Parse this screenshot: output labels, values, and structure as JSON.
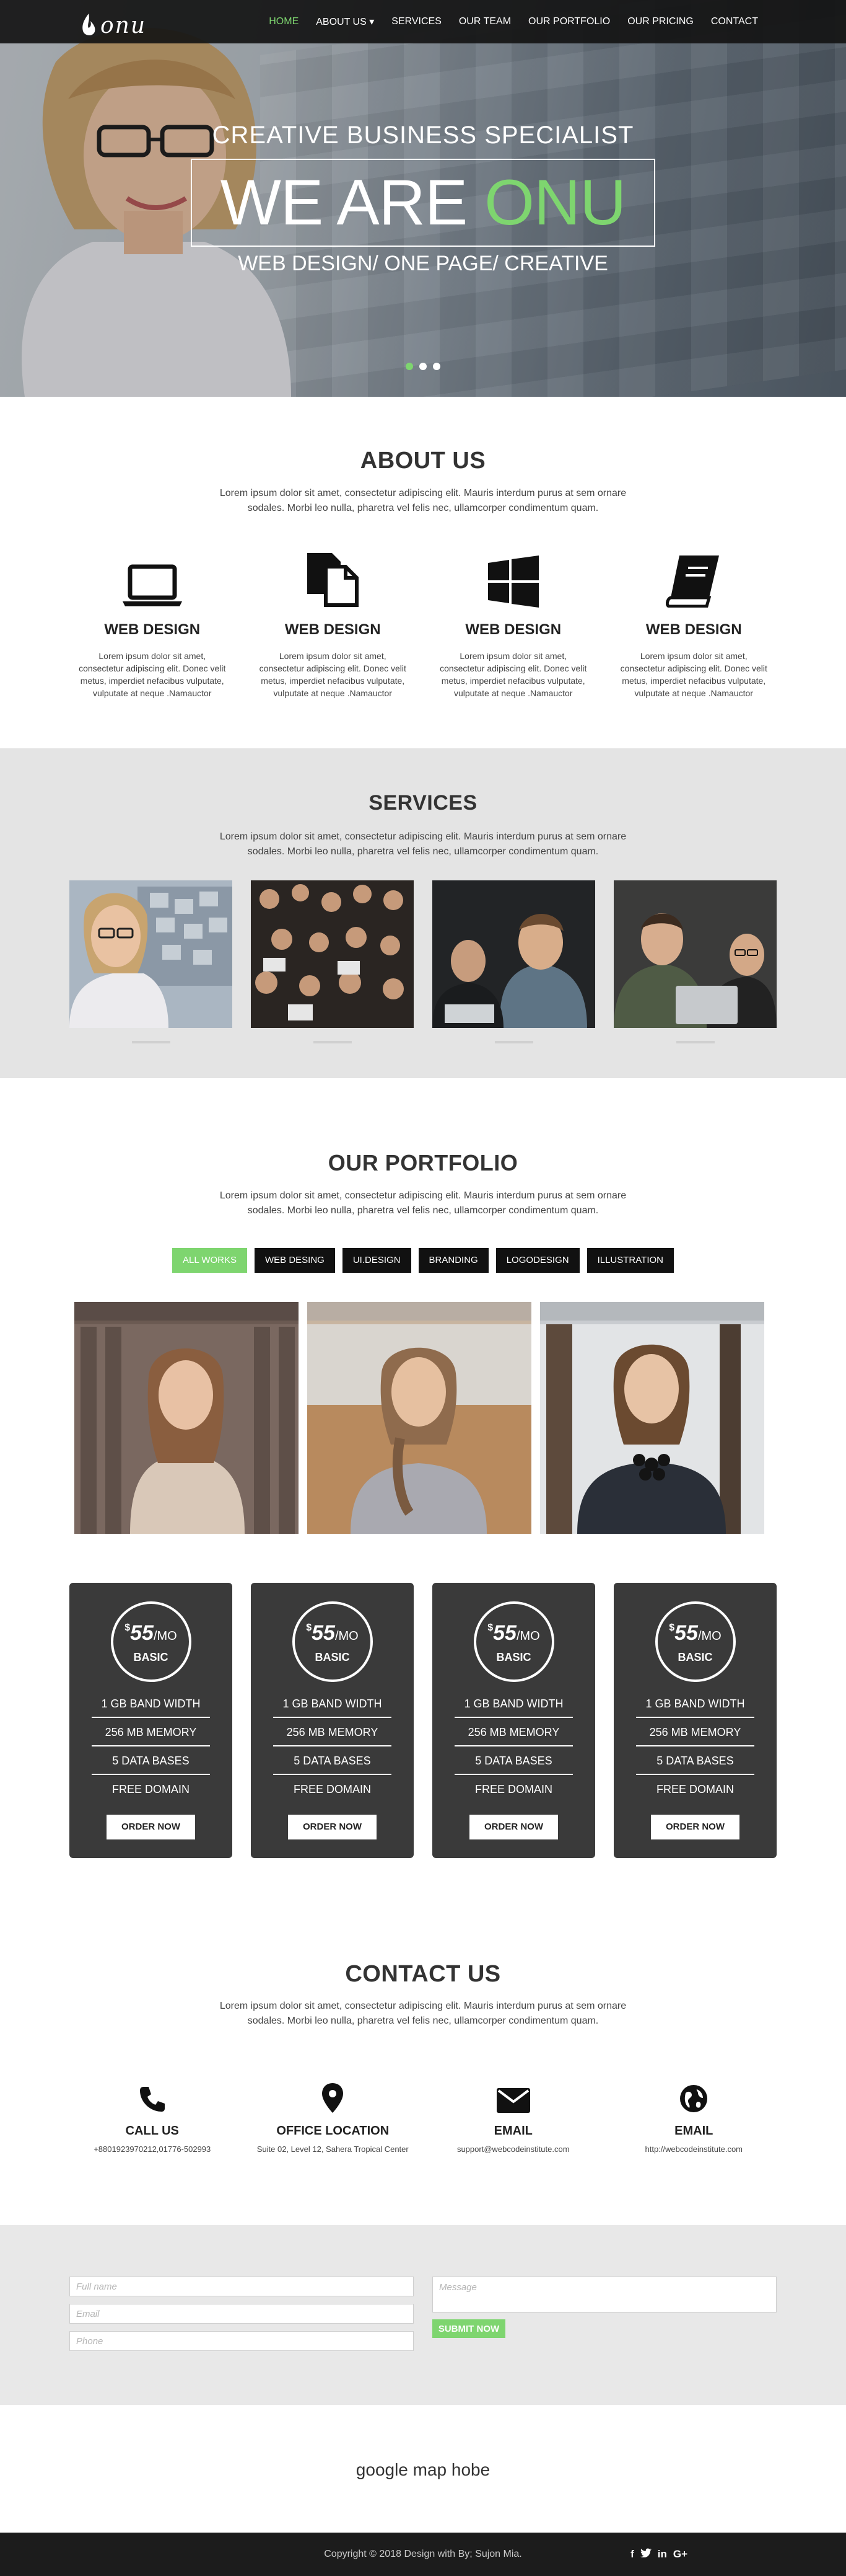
{
  "nav": {
    "logo_text": "onu",
    "items": [
      {
        "label": "HOME"
      },
      {
        "label": "ABOUT US ▾"
      },
      {
        "label": "SERVICES"
      },
      {
        "label": "OUR TEAM"
      },
      {
        "label": "OUR PORTFOLIO"
      },
      {
        "label": "OUR PRICING"
      },
      {
        "label": "CONTACT"
      }
    ],
    "active_color": "#7ed56f"
  },
  "hero": {
    "subtitle_top": "CREATIVE BUSINESS SPECIALIST",
    "title_main": "WE ARE",
    "title_accent": "ONU",
    "subtitle_bottom": "WEB DESIGN/ ONE PAGE/ CREATIVE",
    "slides_total": 3,
    "active_slide": 1
  },
  "about": {
    "title": "ABOUT US",
    "desc": "Lorem ipsum dolor sit amet, consectetur adipiscing elit. Mauris interdum purus at sem ornare sodales. Morbi leo nulla, pharetra vel felis nec, ullamcorper condimentum quam.",
    "features": [
      {
        "icon": "laptop-icon",
        "title": "WEB DESIGN",
        "text": "Lorem ipsum dolor sit amet, consectetur adipiscing elit. Donec velit metus, imperdiet nefacibus vulputate, vulputate at neque .Namauctor"
      },
      {
        "icon": "files-icon",
        "title": "WEB DESIGN",
        "text": "Lorem ipsum dolor sit amet, consectetur adipiscing elit. Donec velit metus, imperdiet nefacibus vulputate, vulputate at neque .Namauctor"
      },
      {
        "icon": "windows-icon",
        "title": "WEB DESIGN",
        "text": "Lorem ipsum dolor sit amet, consectetur adipiscing elit. Donec velit metus, imperdiet nefacibus vulputate, vulputate at neque .Namauctor"
      },
      {
        "icon": "book-icon",
        "title": "WEB DESIGN",
        "text": "Lorem ipsum dolor sit amet, consectetur adipiscing elit. Donec velit metus, imperdiet nefacibus vulputate, vulputate at neque .Namauctor"
      }
    ]
  },
  "services": {
    "title": "SERVICES",
    "desc": "Lorem ipsum dolor sit amet, consectetur adipiscing elit. Mauris interdum purus at sem ornare sodales. Morbi leo nulla, pharetra vel felis nec, ullamcorper condimentum quam.",
    "background": "#e4e4e4"
  },
  "portfolio": {
    "title": "OUR PORTFOLIO",
    "desc": "Lorem ipsum dolor sit amet, consectetur adipiscing elit. Mauris interdum purus at sem ornare sodales. Morbi leo nulla, pharetra vel felis nec, ullamcorper condimentum quam.",
    "filters": [
      {
        "label": "ALL WORKS"
      },
      {
        "label": "WEB DESING"
      },
      {
        "label": "UI.DESIGN"
      },
      {
        "label": "BRANDING"
      },
      {
        "label": "LOGODESIGN"
      },
      {
        "label": "ILLUSTRATION"
      }
    ]
  },
  "pricing": {
    "plans": [
      {
        "currency": "$",
        "amount": "55",
        "period": "/MO",
        "name": "BASIC",
        "features": [
          "1 GB BAND WIDTH",
          "256 MB MEMORY",
          "5 DATA BASES",
          "FREE DOMAIN"
        ],
        "button": "ORDER NOW"
      },
      {
        "currency": "$",
        "amount": "55",
        "period": "/MO",
        "name": "BASIC",
        "features": [
          "1 GB BAND WIDTH",
          "256 MB MEMORY",
          "5 DATA BASES",
          "FREE DOMAIN"
        ],
        "button": "ORDER NOW"
      },
      {
        "currency": "$",
        "amount": "55",
        "period": "/MO",
        "name": "BASIC",
        "features": [
          "1 GB BAND WIDTH",
          "256 MB MEMORY",
          "5 DATA BASES",
          "FREE DOMAIN"
        ],
        "button": "ORDER NOW"
      },
      {
        "currency": "$",
        "amount": "55",
        "period": "/MO",
        "name": "BASIC",
        "features": [
          "1 GB BAND WIDTH",
          "256 MB MEMORY",
          "5 DATA BASES",
          "FREE DOMAIN"
        ],
        "button": "ORDER NOW"
      }
    ]
  },
  "contact": {
    "title": "CONTACT US",
    "desc": "Lorem ipsum dolor sit amet, consectetur adipiscing elit. Mauris interdum purus at sem ornare sodales. Morbi leo nulla, pharetra vel felis nec, ullamcorper condimentum quam.",
    "items": [
      {
        "icon": "phone-icon",
        "title": "CALL US",
        "text": "+8801923970212,01776-502993"
      },
      {
        "icon": "location-pin-icon",
        "title": "OFFICE LOCATION",
        "text": "Suite 02, Level 12, Sahera Tropical Center"
      },
      {
        "icon": "envelope-icon",
        "title": "EMAIL",
        "text": "support@webcodeinstitute.com"
      },
      {
        "icon": "globe-icon",
        "title": "EMAIL",
        "text": "http://webcodeinstitute.com"
      }
    ]
  },
  "form": {
    "fullname_placeholder": "Full name",
    "email_placeholder": "Email",
    "phone_placeholder": "Phone",
    "message_placeholder": "Message",
    "submit_label": "SUBMIT NOW"
  },
  "map": {
    "text": "google map hobe"
  },
  "footer": {
    "copyright": "Copyright © 2018 Design with By; Sujon Mia.",
    "social": [
      {
        "icon": "facebook-icon",
        "glyph": "f"
      },
      {
        "icon": "twitter-icon",
        "glyph": "🐦"
      },
      {
        "icon": "linkedin-icon",
        "glyph": "in"
      },
      {
        "icon": "googleplus-icon",
        "glyph": "G+"
      }
    ]
  },
  "colors": {
    "accent": "#7ed56f",
    "dark_card": "#3a3a3a",
    "footer_bg": "#1c1c1c",
    "navbar_bg": "#141414"
  }
}
